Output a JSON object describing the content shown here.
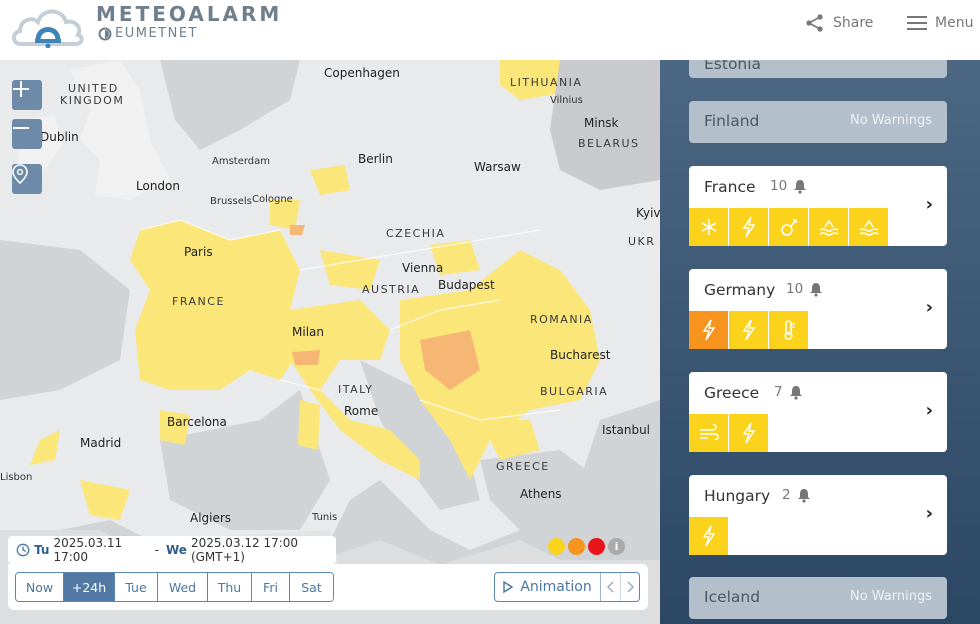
{
  "header": {
    "brand_title": "METEOALARM",
    "brand_sub": "EUMETNET",
    "share_label": "Share",
    "menu_label": "Menu"
  },
  "map": {
    "labels": {
      "united_kingdom_1": "UNITED",
      "united_kingdom_2": "KINGDOM",
      "dublin": "Dublin",
      "london": "London",
      "amsterdam": "Amsterdam",
      "brussels": "Brussels",
      "cologne": "Cologne",
      "paris": "Paris",
      "france": "FRANCE",
      "copenhagen": "Copenhagen",
      "lithuania": "LITHUANIA",
      "vilnius": "Vilnius",
      "minsk": "Minsk",
      "belarus": "BELARUS",
      "berlin": "Berlin",
      "warsaw": "Warsaw",
      "kyiv": "Kyiv",
      "ukr": "UKR",
      "czechia": "CZECHIA",
      "vienna": "Vienna",
      "austria": "AUSTRIA",
      "budapest": "Budapest",
      "romania": "ROMANIA",
      "bucharest": "Bucharest",
      "milan": "Milan",
      "italy": "ITALY",
      "rome": "Rome",
      "bulgaria": "BULGARIA",
      "istanbul": "Istanbul",
      "greece": "GREECE",
      "athens": "Athens",
      "barcelona": "Barcelona",
      "madrid": "Madrid",
      "lisbon": "Lisbon",
      "algiers": "Algiers",
      "tunis": "Tunis"
    },
    "zoom_in": "+",
    "zoom_out": "−"
  },
  "time_range": {
    "from_day": "Tu",
    "from_time": "2025.03.11 17:00",
    "separator": "-",
    "to_day": "We",
    "to_time": "2025.03.12 17:00 (GMT+1)"
  },
  "legend": {
    "colors": [
      "#fbd31c",
      "#f7941d",
      "#e8161b"
    ],
    "info": "i"
  },
  "days": [
    {
      "label": "Now",
      "active": false
    },
    {
      "label": "+24h",
      "active": true
    },
    {
      "label": "Tue",
      "active": false
    },
    {
      "label": "Wed",
      "active": false
    },
    {
      "label": "Thu",
      "active": false
    },
    {
      "label": "Fri",
      "active": false
    },
    {
      "label": "Sat",
      "active": false
    }
  ],
  "animation_label": "Animation",
  "countries": {
    "estonia": {
      "name": "Estonia"
    },
    "finland": {
      "name": "Finland",
      "status": "No Warnings"
    },
    "france": {
      "name": "France",
      "count": "10",
      "icons": [
        "snow-ice-icon",
        "thunderstorm-icon",
        "avalanche-icon",
        "flooding-icon",
        "flooding-icon"
      ]
    },
    "germany": {
      "name": "Germany",
      "count": "10",
      "icons": [
        "thunderstorm-icon",
        "thunderstorm-icon",
        "high-temperature-icon"
      ]
    },
    "greece": {
      "name": "Greece",
      "count": "7",
      "icons": [
        "wind-icon",
        "thunderstorm-icon"
      ]
    },
    "hungary": {
      "name": "Hungary",
      "count": "2",
      "icons": [
        "thunderstorm-icon"
      ]
    },
    "iceland": {
      "name": "Iceland",
      "status": "No Warnings"
    }
  }
}
